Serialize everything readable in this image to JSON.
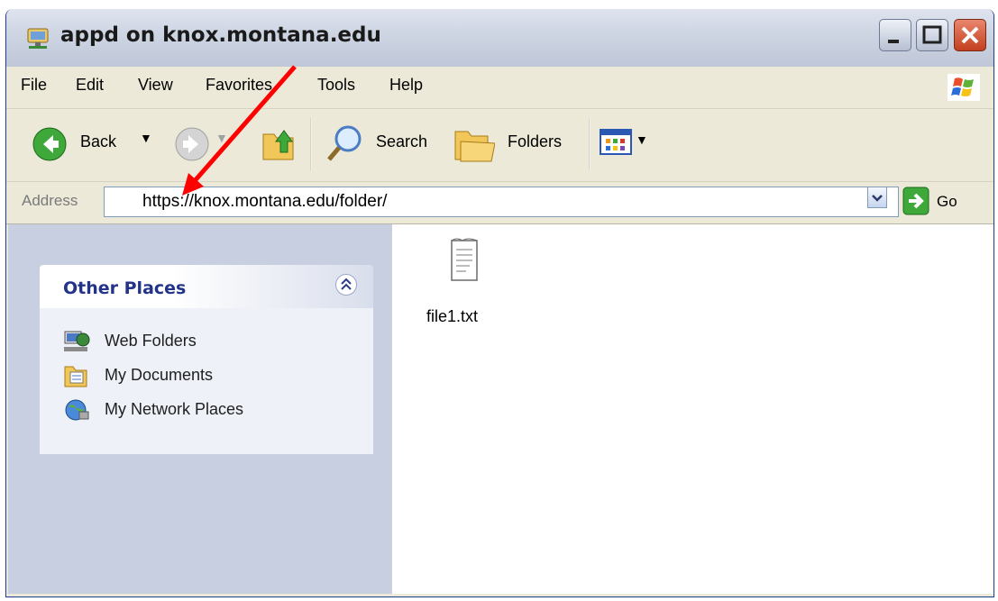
{
  "window": {
    "title": "appd on knox.montana.edu"
  },
  "menu": {
    "items": [
      "File",
      "Edit",
      "View",
      "Favorites",
      "Tools",
      "Help"
    ]
  },
  "toolbar": {
    "back_label": "Back",
    "search_label": "Search",
    "folders_label": "Folders"
  },
  "address": {
    "label": "Address",
    "value": "https://knox.montana.edu/folder/",
    "go_label": "Go"
  },
  "sidebar": {
    "other_places": {
      "title": "Other Places",
      "items": [
        {
          "label": "Web Folders",
          "icon": "web-folders-icon"
        },
        {
          "label": "My Documents",
          "icon": "my-documents-icon"
        },
        {
          "label": "My Network Places",
          "icon": "network-places-icon"
        }
      ]
    }
  },
  "files": [
    {
      "name": "file1.txt",
      "icon": "text-file-icon"
    }
  ],
  "colors": {
    "annotation_arrow": "#ff0000",
    "sidebar_bg": "#c7cfe1",
    "panel_title": "#23338a"
  }
}
